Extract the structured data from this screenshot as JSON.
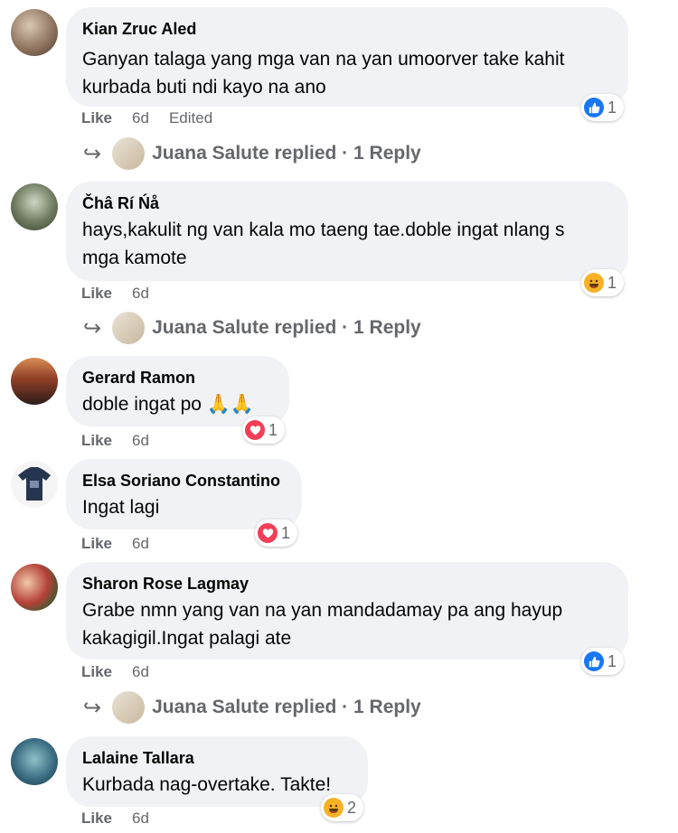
{
  "comments": [
    {
      "name": "Kian Zruc Aled",
      "lines": [
        "Ganyan talaga yang mga van na yan umoorver take kahit",
        "kurbada buti ndi kayo na ano"
      ],
      "reaction_type": "like",
      "reaction_count": "1",
      "actions": {
        "like": "Like",
        "time": "6d",
        "edited": "Edited"
      },
      "replies": {
        "text": "Juana Salute replied · 1 Reply"
      }
    },
    {
      "name": "Čhâ Rí Ńå",
      "lines": [
        "hays,kakulit ng van kala mo taeng tae.doble ingat nlang s",
        "mga kamote"
      ],
      "reaction_type": "haha",
      "reaction_count": "1",
      "actions": {
        "like": "Like",
        "time": "6d"
      },
      "replies": {
        "text": "Juana Salute replied · 1 Reply"
      }
    },
    {
      "name": "Gerard Ramon",
      "lines": [
        "doble ingat po 🙏🙏"
      ],
      "reaction_type": "love",
      "reaction_count": "1",
      "actions": {
        "like": "Like",
        "time": "6d"
      }
    },
    {
      "name": "Elsa Soriano Constantino",
      "lines": [
        "Ingat lagi"
      ],
      "reaction_type": "love",
      "reaction_count": "1",
      "actions": {
        "like": "Like",
        "time": "6d"
      }
    },
    {
      "name": "Sharon Rose Lagmay",
      "lines": [
        "Grabe nmn yang van na yan mandadamay pa ang hayup",
        "kakagigil.Ingat palagi ate"
      ],
      "reaction_type": "like",
      "reaction_count": "1",
      "actions": {
        "like": "Like",
        "time": "6d"
      },
      "replies": {
        "text": "Juana Salute replied · 1 Reply"
      }
    },
    {
      "name": "Lalaine Tallara",
      "lines": [
        "Kurbada nag-overtake. Takte!"
      ],
      "reaction_type": "haha",
      "reaction_count": "2",
      "actions": {
        "like": "Like",
        "time": "6d"
      }
    }
  ],
  "colors": {
    "bubble": "#f0f2f5",
    "like_blue": "#1877f2",
    "love_red": "#f33e58",
    "haha_yellow": "#f7b125",
    "meta_gray": "#65676b"
  }
}
